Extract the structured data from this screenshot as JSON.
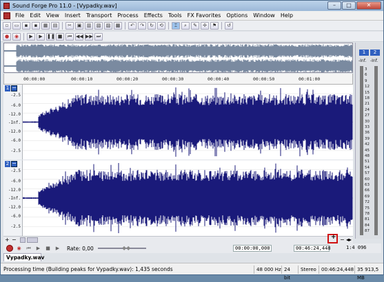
{
  "window": {
    "title": "Sound Forge Pro 11.0 - [Vypadky.wav]",
    "buttons": {
      "minimize": "–",
      "maximize": "□",
      "close": "✕"
    }
  },
  "menu": [
    "File",
    "Edit",
    "View",
    "Insert",
    "Transport",
    "Process",
    "Effects",
    "Tools",
    "FX Favorites",
    "Options",
    "Window",
    "Help"
  ],
  "ruler": {
    "labels": [
      "00:00:00",
      "00:00:10",
      "00:00:20",
      "00:00:30",
      "00:00:40",
      "00:00:50",
      "00:01:00"
    ]
  },
  "channels": [
    {
      "number": "1",
      "db_labels": [
        "-Inf.",
        "-2.5",
        "-6.0",
        "-12.0",
        "-Inf.",
        "-12.0",
        "-6.0",
        "-2.5"
      ]
    },
    {
      "number": "2",
      "db_labels": [
        "-Inf.",
        "-2.5",
        "-6.0",
        "-12.0",
        "-Inf.",
        "-12.0",
        "-6.0",
        "-2.5"
      ]
    }
  ],
  "meter": {
    "ch1": "1",
    "ch2": "2",
    "inf_left": "-Inf.",
    "inf_right": "-Inf.",
    "scale": [
      "3",
      "6",
      "9",
      "12",
      "15",
      "18",
      "21",
      "24",
      "27",
      "30",
      "33",
      "36",
      "39",
      "42",
      "45",
      "48",
      "51",
      "54",
      "57",
      "60",
      "63",
      "66",
      "69",
      "72",
      "75",
      "78",
      "81",
      "84",
      "87"
    ]
  },
  "transport": {
    "rate_label": "Rate: 0,00",
    "cursor_position": "00:00:00,000",
    "selection_length": "00:46:24,448",
    "zoom_ratio": "1:4 096"
  },
  "doc_tab": "Vypadky.wav",
  "status": {
    "message": "Processing time (Building peaks for Vypadky.wav): 1,435 seconds",
    "sample_rate": "48 000 Hz",
    "bit_depth": "24 bit",
    "channels": "Stereo",
    "length": "00:46:24,448",
    "disk_space": "35 913,5 MB"
  },
  "colors": {
    "waveform": "#1a1a7a",
    "accent": "#3060c0",
    "highlight": "#d01010"
  }
}
